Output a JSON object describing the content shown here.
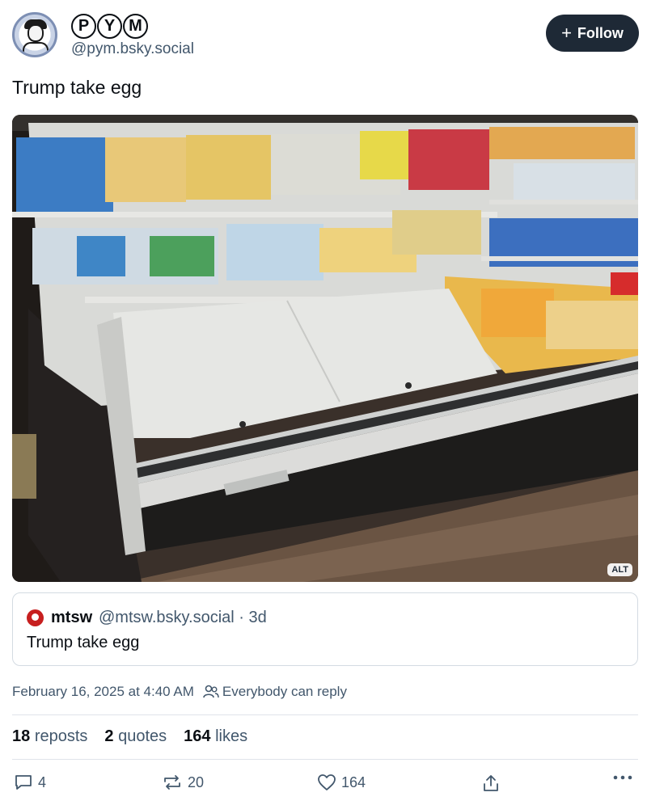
{
  "author": {
    "display_name_letters": [
      "P",
      "Y",
      "M"
    ],
    "handle": "@pym.bsky.social",
    "avatar_icon": "cartoon-portrait-avatar"
  },
  "follow_button": {
    "label": "Follow",
    "icon": "plus-icon"
  },
  "post": {
    "text": "Trump take egg"
  },
  "image": {
    "alt_badge": "ALT"
  },
  "quoted_post": {
    "author_name": "mtsw",
    "handle_time": "@mtsw.bsky.social · 3d",
    "text": "Trump take egg"
  },
  "meta": {
    "timestamp": "February 16, 2025 at 4:40 AM",
    "reply_setting": "Everybody can reply"
  },
  "stats": {
    "reposts_count": "18",
    "reposts_label": "reposts",
    "quotes_count": "2",
    "quotes_label": "quotes",
    "likes_count": "164",
    "likes_label": "likes"
  },
  "actions": {
    "reply_count": "4",
    "repost_count": "20",
    "like_count": "164"
  },
  "colors": {
    "follow_bg": "#1e2936",
    "secondary_text": "#42576c",
    "border": "#d4dbe2",
    "quote_avatar": "#c71f1f"
  }
}
